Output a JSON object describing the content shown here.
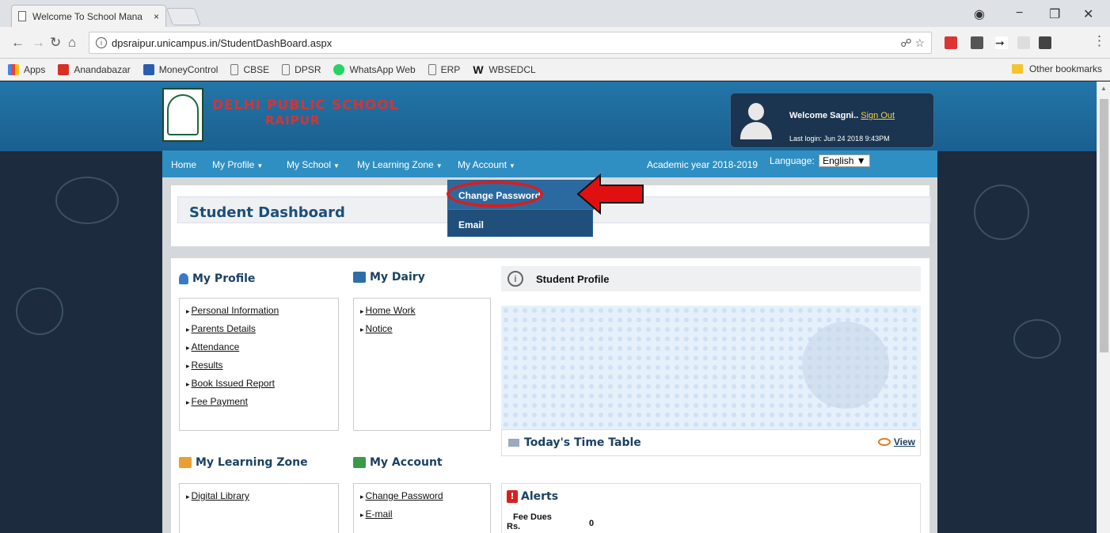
{
  "browser": {
    "tab_title": "Welcome To School Mana",
    "tab_close": "×",
    "url": "dpsraipur.unicampus.in/StudentDashBoard.aspx",
    "win_controls": [
      "−",
      "❐",
      "✕"
    ],
    "bookmarks": [
      {
        "label": "Apps",
        "color": "#4285f4"
      },
      {
        "label": "Anandabazar",
        "color": "#d93025"
      },
      {
        "label": "MoneyControl",
        "color": "#2a5db0"
      },
      {
        "label": "CBSE",
        "color": "#ffffff"
      },
      {
        "label": "DPSR",
        "color": "#ffffff"
      },
      {
        "label": "WhatsApp Web",
        "color": "#25d366"
      },
      {
        "label": "ERP",
        "color": "#ffffff"
      },
      {
        "label": "WBSEDCL",
        "color": "#111111"
      }
    ],
    "other_bookmarks": "Other bookmarks"
  },
  "header": {
    "school_name": "DELHI PUBLIC SCHOOL",
    "school_city": "RAIPUR",
    "welcome_prefix": "Welcome Sagni..",
    "sign_out": "Sign Out",
    "last_login": "Last login: Jun 24 2018 9:43PM"
  },
  "menu": {
    "home": "Home",
    "my_profile": "My Profile",
    "my_school": "My School",
    "my_learning_zone": "My Learning Zone",
    "my_account": "My Account",
    "academic_year": "Academic year 2018-2019",
    "language_label": "Language:",
    "language_value": "English"
  },
  "dropdown": {
    "items": [
      "Change Password",
      "Email"
    ]
  },
  "dashboard": {
    "title": "Student Dashboard"
  },
  "profile_section": {
    "title": "My Profile",
    "items": [
      "Personal Information",
      "Parents Details",
      "Attendance",
      "Results",
      "Book Issued Report",
      "Fee Payment"
    ]
  },
  "dairy_section": {
    "title": "My Dairy",
    "items": [
      "Home Work",
      "Notice"
    ]
  },
  "learning_section": {
    "title": "My Learning Zone",
    "items": [
      "Digital Library"
    ]
  },
  "account_section": {
    "title": "My Account",
    "items": [
      "Change Password",
      "E-mail"
    ]
  },
  "student_profile": {
    "title": "Student Profile",
    "info_icon": "i"
  },
  "timetable": {
    "title": "Today's Time Table",
    "view": "View"
  },
  "alerts": {
    "title": "Alerts",
    "icon": "!",
    "fee_label_1": "Fee Dues",
    "fee_label_2": "Rs.",
    "fee_value": "0"
  },
  "colors": {
    "accent": "#2f8fc2",
    "highlight": "#d81e1e"
  }
}
